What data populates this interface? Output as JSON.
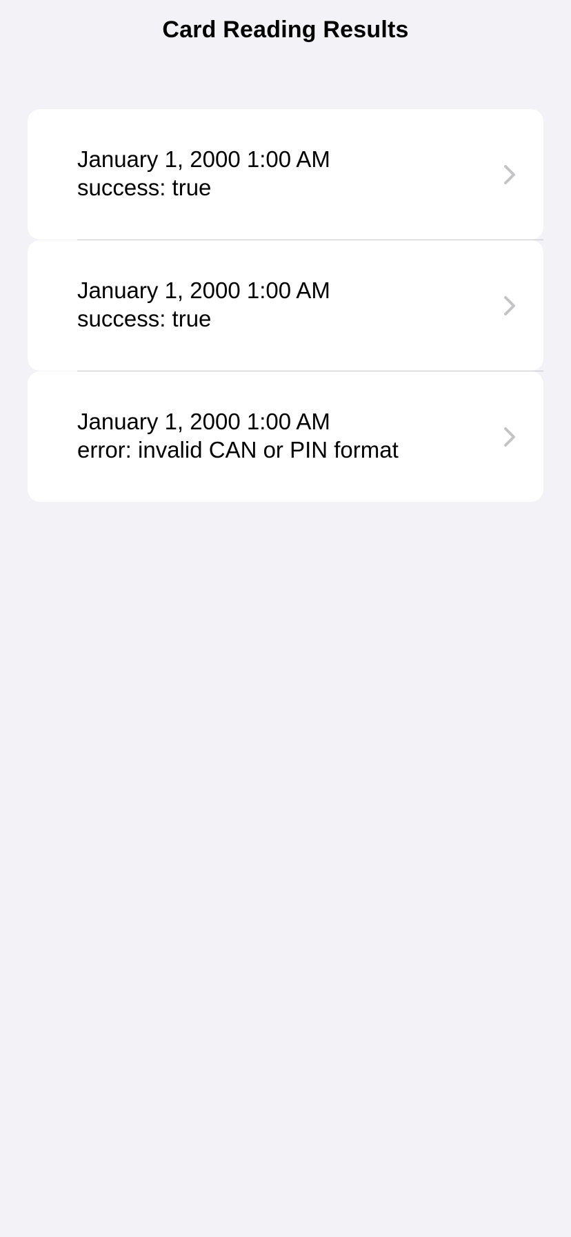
{
  "header": {
    "title": "Card Reading Results"
  },
  "results": [
    {
      "timestamp": "January 1, 2000  1:00 AM",
      "status": "success: true",
      "icon": "chevron-right-icon"
    },
    {
      "timestamp": "January 1, 2000  1:00 AM",
      "status": "success: true",
      "icon": "chevron-right-icon"
    },
    {
      "timestamp": "January 1, 2000  1:00 AM",
      "status": "error: invalid CAN or PIN format",
      "icon": "chevron-right-icon"
    }
  ],
  "colors": {
    "background": "#f2f2f7",
    "card": "#ffffff",
    "chevron": "#c4c4c6",
    "separator": "#c6c6c8"
  }
}
